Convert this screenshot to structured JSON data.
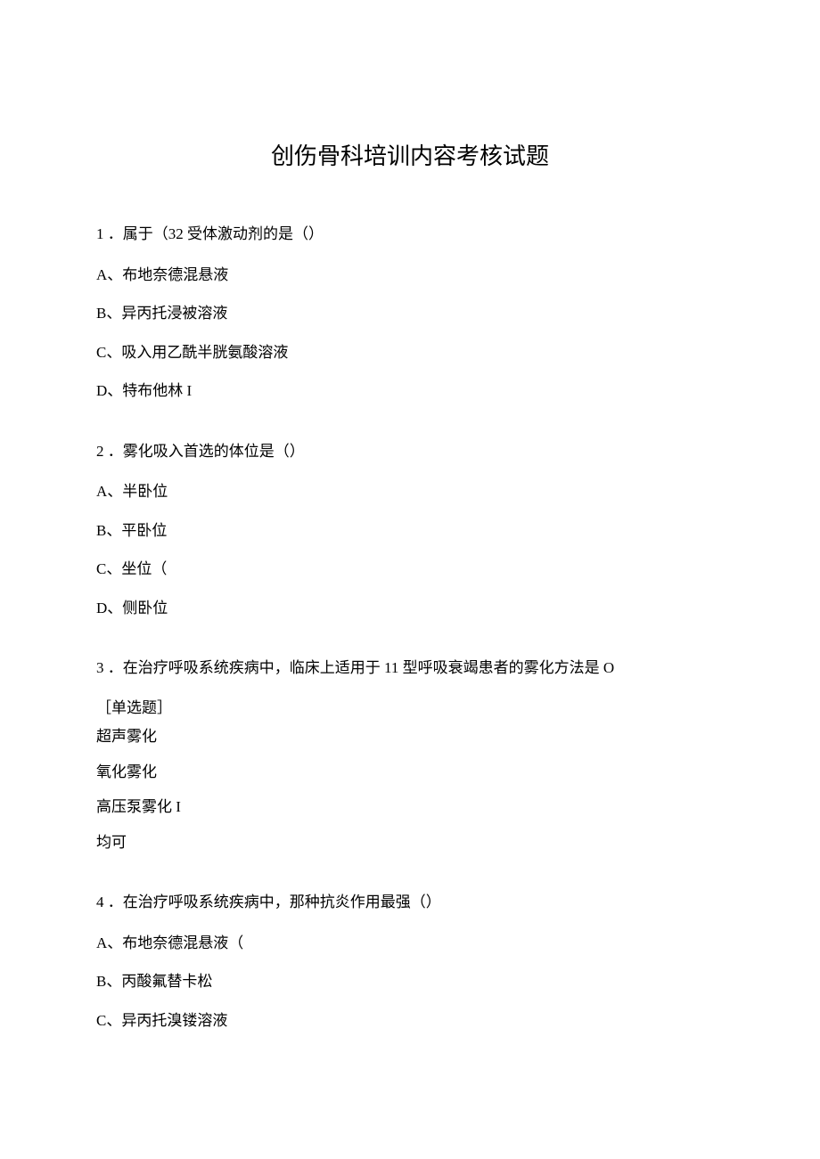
{
  "title": "创伤骨科培训内容考核试题",
  "q1": {
    "stem": "1 ．属于（32 受体激动剂的是（）",
    "a": "A、布地奈德混悬液",
    "b": "B、异丙托浸被溶液",
    "c": "C、吸入用乙酰半胱氨酸溶液",
    "d": "D、特布他林 I"
  },
  "q2": {
    "stem": "2 ．雾化吸入首选的体位是（）",
    "a": "A、半卧位",
    "b": "B、平卧位",
    "c": "C、坐位（",
    "d": "D、侧卧位"
  },
  "q3": {
    "stem": "3 ．在治疗呼吸系统疾病中，临床上适用于 11 型呼吸衰竭患者的雾化方法是 O",
    "sub": "［单选题］",
    "a": "超声雾化",
    "b": "氧化雾化",
    "c": "高压泵雾化 I",
    "d": "均可"
  },
  "q4": {
    "stem": "4 ．在治疗呼吸系统疾病中，那种抗炎作用最强（）",
    "a": "A、布地奈德混悬液（",
    "b": "B、丙酸氟替卡松",
    "c": "C、异丙托溴镂溶液"
  }
}
